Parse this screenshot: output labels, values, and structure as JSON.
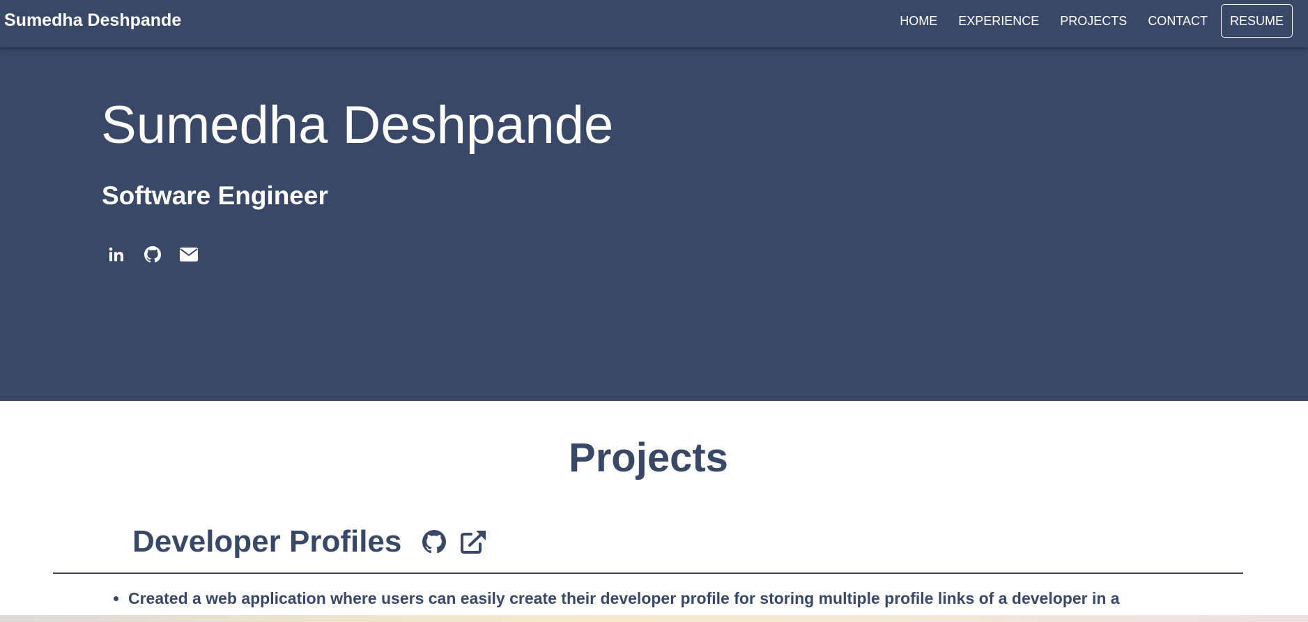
{
  "nav": {
    "brand": "Sumedha Deshpande",
    "links": [
      "HOME",
      "EXPERIENCE",
      "PROJECTS",
      "CONTACT"
    ],
    "resume": "RESUME"
  },
  "hero": {
    "name": "Sumedha Deshpande",
    "role": "Software Engineer",
    "socials": [
      "linkedin-icon",
      "github-icon",
      "envelope-icon"
    ]
  },
  "projects": {
    "title": "Projects",
    "items": [
      {
        "name": "Developer Profiles",
        "icons": [
          "github-icon",
          "external-link-icon"
        ],
        "bullets": [
          "Created a web application where users can easily create their developer profile for storing multiple profile links of a developer in a"
        ]
      }
    ]
  },
  "colors": {
    "primary": "#394867",
    "text_on_primary": "#ffffff",
    "background": "#ffffff"
  }
}
